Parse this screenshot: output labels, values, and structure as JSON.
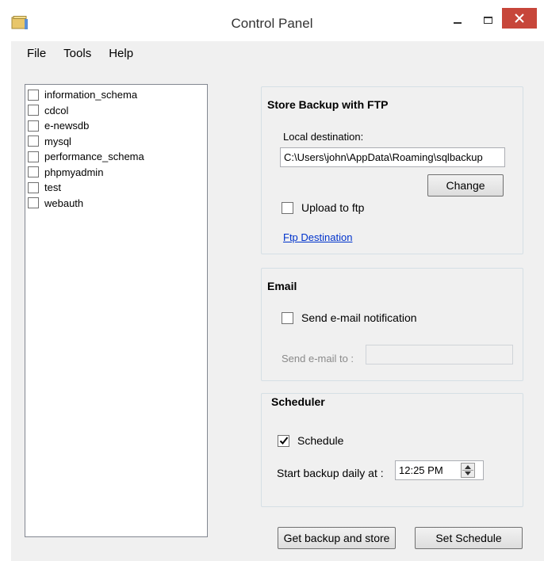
{
  "window": {
    "title": "Control Panel",
    "close_color": "#c7463a"
  },
  "menu": [
    "File",
    "Tools",
    "Help"
  ],
  "databases": [
    {
      "name": "information_schema",
      "checked": false
    },
    {
      "name": "cdcol",
      "checked": false
    },
    {
      "name": "e-newsdb",
      "checked": false
    },
    {
      "name": "mysql",
      "checked": false
    },
    {
      "name": "performance_schema",
      "checked": false
    },
    {
      "name": "phpmyadmin",
      "checked": false
    },
    {
      "name": "test",
      "checked": false
    },
    {
      "name": "webauth",
      "checked": false
    }
  ],
  "ftp": {
    "title": "Store Backup with FTP",
    "local_destination_label": "Local destination:",
    "local_destination_value": "C:\\Users\\john\\AppData\\Roaming\\sqlbackup",
    "change_button": "Change",
    "upload_label": "Upload to ftp",
    "upload_checked": false,
    "ftp_destination_link": "Ftp Destination"
  },
  "email": {
    "title": "Email",
    "notify_label": "Send e-mail notification",
    "notify_checked": false,
    "send_to_label": "Send e-mail to :",
    "send_to_value": ""
  },
  "scheduler": {
    "title": "Scheduler",
    "schedule_label": "Schedule",
    "schedule_checked": true,
    "start_label": "Start backup daily at :",
    "time_value": "12:25 PM"
  },
  "actions": {
    "backup_button": "Get backup and store",
    "set_schedule_button": "Set Schedule"
  }
}
